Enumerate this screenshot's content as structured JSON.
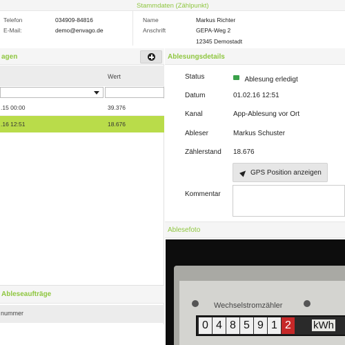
{
  "stammdaten": {
    "title": "Stammdaten (Zählpunkt)",
    "phone_label": "Telefon",
    "phone_value": "034909-84816",
    "email_label": "E-Mail:",
    "email_value": "demo@envago.de",
    "name_label": "Name",
    "name_value": "Markus Richter",
    "address_label": "Anschrift",
    "address_line1": "GEPA-Weg 2",
    "address_line2": "12345 Demostadt"
  },
  "readings": {
    "title": "agen",
    "column_wert": "Wert",
    "rows": [
      {
        "date": ".15 00:00",
        "value": "39.376"
      },
      {
        "date": ".16 12:51",
        "value": "18.676"
      }
    ]
  },
  "details": {
    "title": "Ablesungsdetails",
    "status_label": "Status",
    "status_value": "Ablesung erledigt",
    "datum_label": "Datum",
    "datum_value": "01.02.16 12:51",
    "kanal_label": "Kanal",
    "kanal_value": "App-Ablesung vor Ort",
    "ableser_label": "Ableser",
    "ableser_value": "Markus Schuster",
    "zaehlerstand_label": "Zählerstand",
    "zaehlerstand_value": "18.676",
    "gps_button": "GPS Position anzeigen",
    "kommentar_label": "Kommentar",
    "kommentar_value": ""
  },
  "photo": {
    "title": "Ablesefoto",
    "meter_text": "Wechselstromzähler",
    "digits": [
      "0",
      "4",
      "8",
      "5",
      "9",
      "1",
      "2"
    ],
    "unit": "kWh"
  },
  "auftraege": {
    "title": "Ableseaufträge",
    "column": "nummer"
  },
  "colors": {
    "accent": "#8ec63f",
    "selected_row": "#b9dc4a"
  }
}
